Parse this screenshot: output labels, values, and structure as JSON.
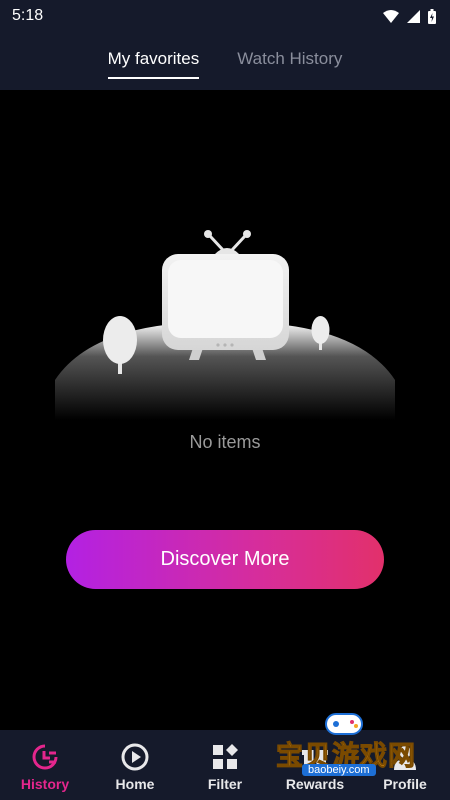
{
  "status_bar": {
    "time": "5:18"
  },
  "tabs": [
    {
      "label": "My favorites",
      "active": true
    },
    {
      "label": "Watch History",
      "active": false
    }
  ],
  "empty_state": {
    "message": "No items"
  },
  "cta": {
    "label": "Discover More"
  },
  "bottom_nav": [
    {
      "label": "History",
      "icon": "history-icon",
      "active": true
    },
    {
      "label": "Home",
      "icon": "play-circle-icon",
      "active": false
    },
    {
      "label": "Filter",
      "icon": "filter-grid-icon",
      "active": false
    },
    {
      "label": "Rewards",
      "icon": "gift-icon",
      "active": false
    },
    {
      "label": "Profile",
      "icon": "profile-icon",
      "active": false
    }
  ],
  "watermark": {
    "title": "宝贝游戏网",
    "url": "baobeiy.com"
  },
  "colors": {
    "bar_background": "#151a2b",
    "accent_pink": "#e4268d",
    "gradient_start": "#b321e3",
    "gradient_end": "#e2306b"
  }
}
